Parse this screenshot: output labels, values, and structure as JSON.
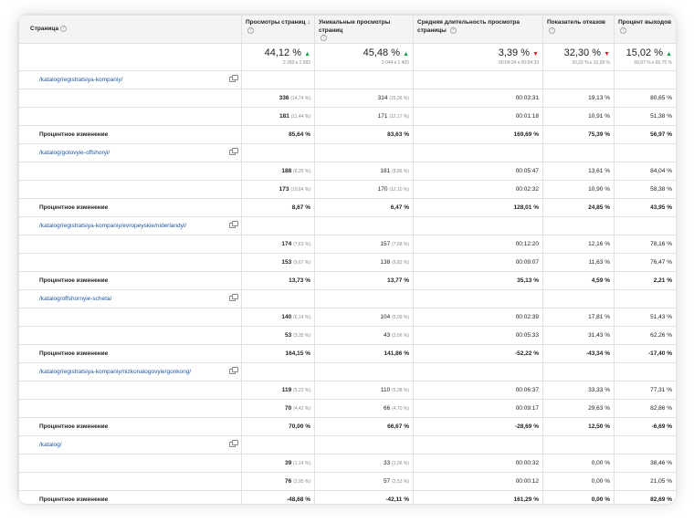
{
  "headers": {
    "page": "Страница",
    "pageviews": "Просмотры страниц",
    "unique": "Уникальные просмотры страниц",
    "avg_time": "Средняя длительность просмотра страницы",
    "bounce": "Показатель отказов",
    "exit": "Процент выходов",
    "sort_arrow": "↓"
  },
  "totals": {
    "pageviews": {
      "main": "44,12 %",
      "sub": "2 280 к 1 582",
      "dir": "up"
    },
    "unique": {
      "main": "45,48 %",
      "sub": "2 044 к 1 405",
      "dir": "up"
    },
    "avg_time": {
      "main": "3,39 %",
      "sub": "00:04:24 к 00:04:33",
      "dir": "down"
    },
    "bounce": {
      "main": "32,30 %",
      "sub": "20,22 % к 15,28 %",
      "dir": "down"
    },
    "exit": {
      "main": "15,02 %",
      "sub": "69,87 % к 60,75 %",
      "dir": "up"
    }
  },
  "groups": [
    {
      "url": "/katalog/registratsiya-kompaniy/",
      "rows": [
        {
          "pv": "336",
          "pv_sub": "(14,74 %)",
          "uv": "314",
          "uv_sub": "(15,36 %)",
          "time": "00:03:31",
          "bounce": "19,13 %",
          "exit": "80,65 %"
        },
        {
          "pv": "181",
          "pv_sub": "(11,44 %)",
          "uv": "171",
          "uv_sub": "(12,17 %)",
          "time": "00:01:18",
          "bounce": "10,91 %",
          "exit": "51,38 %"
        }
      ],
      "change": {
        "label": "Процентное изменение",
        "pv": "85,64 %",
        "uv": "83,63 %",
        "time": "169,69 %",
        "bounce": "75,39 %",
        "exit": "56,97 %"
      }
    },
    {
      "url": "/katalog/gotovyie-offshoryi/",
      "rows": [
        {
          "pv": "188",
          "pv_sub": "(8,25 %)",
          "uv": "181",
          "uv_sub": "(8,86 %)",
          "time": "00:05:47",
          "bounce": "13,61 %",
          "exit": "84,04 %"
        },
        {
          "pv": "173",
          "pv_sub": "(10,94 %)",
          "uv": "170",
          "uv_sub": "(12,10 %)",
          "time": "00:02:32",
          "bounce": "10,90 %",
          "exit": "58,38 %"
        }
      ],
      "change": {
        "label": "Процентное изменение",
        "pv": "8,67 %",
        "uv": "6,47 %",
        "time": "128,01 %",
        "bounce": "24,85 %",
        "exit": "43,95 %"
      }
    },
    {
      "url": "/katalog/registratsiya-kompaniy/evropeyskie/niderlandyi/",
      "rows": [
        {
          "pv": "174",
          "pv_sub": "(7,63 %)",
          "uv": "157",
          "uv_sub": "(7,68 %)",
          "time": "00:12:20",
          "bounce": "12,16 %",
          "exit": "78,16 %"
        },
        {
          "pv": "153",
          "pv_sub": "(9,67 %)",
          "uv": "138",
          "uv_sub": "(9,82 %)",
          "time": "00:09:07",
          "bounce": "11,63 %",
          "exit": "76,47 %"
        }
      ],
      "change": {
        "label": "Процентное изменение",
        "pv": "13,73 %",
        "uv": "13,77 %",
        "time": "35,13 %",
        "bounce": "4,59 %",
        "exit": "2,21 %"
      }
    },
    {
      "url": "/katalog/offshornyie-scheta/",
      "rows": [
        {
          "pv": "140",
          "pv_sub": "(6,14 %)",
          "uv": "104",
          "uv_sub": "(5,09 %)",
          "time": "00:02:39",
          "bounce": "17,81 %",
          "exit": "51,43 %"
        },
        {
          "pv": "53",
          "pv_sub": "(3,35 %)",
          "uv": "43",
          "uv_sub": "(3,06 %)",
          "time": "00:05:33",
          "bounce": "31,43 %",
          "exit": "62,26 %"
        }
      ],
      "change": {
        "label": "Процентное изменение",
        "pv": "164,15 %",
        "uv": "141,86 %",
        "time": "-52,22 %",
        "bounce": "-43,34 %",
        "exit": "-17,40 %"
      }
    },
    {
      "url": "/katalog/registratsiya-kompaniy/nizkonalogovyie/gonkong/",
      "rows": [
        {
          "pv": "119",
          "pv_sub": "(5,22 %)",
          "uv": "110",
          "uv_sub": "(5,38 %)",
          "time": "00:06:37",
          "bounce": "33,33 %",
          "exit": "77,31 %"
        },
        {
          "pv": "70",
          "pv_sub": "(4,42 %)",
          "uv": "66",
          "uv_sub": "(4,70 %)",
          "time": "00:09:17",
          "bounce": "29,63 %",
          "exit": "82,86 %"
        }
      ],
      "change": {
        "label": "Процентное изменение",
        "pv": "70,00 %",
        "uv": "66,67 %",
        "time": "-28,69 %",
        "bounce": "12,50 %",
        "exit": "-6,69 %"
      }
    },
    {
      "url": "/katalog/",
      "rows": [
        {
          "pv": "39",
          "pv_sub": "(1,14 %)",
          "uv": "33",
          "uv_sub": "(1,06 %)",
          "time": "00:00:32",
          "bounce": "0,00 %",
          "exit": "38,46 %"
        },
        {
          "pv": "76",
          "pv_sub": "(2,95 %)",
          "uv": "57",
          "uv_sub": "(2,53 %)",
          "time": "00:00:12",
          "bounce": "0,00 %",
          "exit": "21,05 %"
        }
      ],
      "change": {
        "label": "Процентное изменение",
        "pv": "-48,68 %",
        "uv": "-42,11 %",
        "time": "161,29 %",
        "bounce": "0,00 %",
        "exit": "82,69 %"
      }
    }
  ]
}
